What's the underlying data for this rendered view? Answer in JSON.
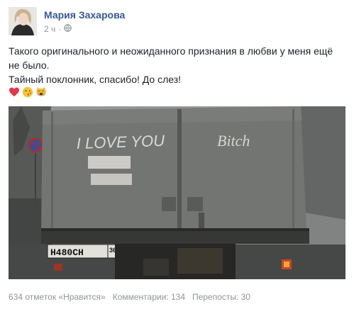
{
  "post": {
    "author": "Мария Захарова",
    "time": "2 ч",
    "audience_icon": "globe-icon",
    "text_lines": [
      "Такого оригинального и неожиданного признания в любви у меня ещё",
      "не было.",
      "Тайный поклонник, спасибо! До слез!"
    ],
    "emojis": [
      "heart-emoji",
      "kissing-face-emoji",
      "crying-cat-emoji"
    ]
  },
  "photo": {
    "graffiti_left": "I LOVE YOU",
    "graffiti_right": "Bitch",
    "plate_number": "Н480СН",
    "plate_region": "36"
  },
  "stats": {
    "likes": "634 отметок «Нравится»",
    "comments": "Комментарии: 134",
    "shares": "Перепосты: 30"
  },
  "colors": {
    "link": "#365899",
    "text": "#1d2129",
    "muted": "#90949c"
  }
}
